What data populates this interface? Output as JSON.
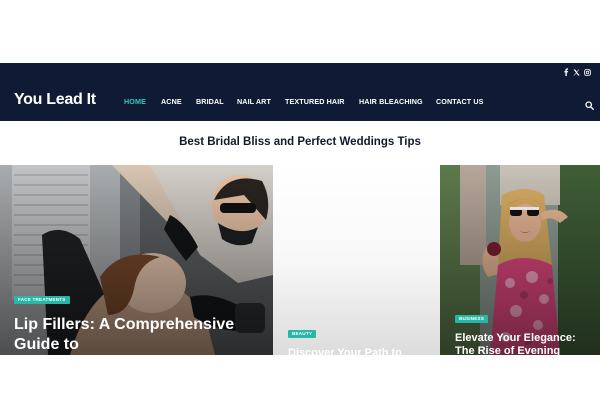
{
  "brand": {
    "logo": "You Lead It"
  },
  "nav": {
    "items": [
      {
        "label": "HOME",
        "active": true
      },
      {
        "label": "ACNE"
      },
      {
        "label": "BRIDAL"
      },
      {
        "label": "NAIL ART"
      },
      {
        "label": "TEXTURED HAIR"
      },
      {
        "label": "HAIR BLEACHING"
      },
      {
        "label": "CONTACT US"
      }
    ]
  },
  "social": [
    "facebook-icon",
    "x-icon",
    "instagram-icon"
  ],
  "section": {
    "heading": "Best Bridal Bliss and Perfect Weddings Tips"
  },
  "cards": [
    {
      "category": "FACE TREATMENTS",
      "title": "Lip Fillers: A Comprehensive Guide to"
    },
    {
      "category": "BEAUTY",
      "title": "Discover Your Path to"
    },
    {
      "category": "BUSINESS",
      "title": "Elevate Your Elegance: The Rise of Evening"
    }
  ],
  "colors": {
    "navy": "#0f1b35",
    "accent": "#35c7c0",
    "badge": "#27b7a6"
  }
}
